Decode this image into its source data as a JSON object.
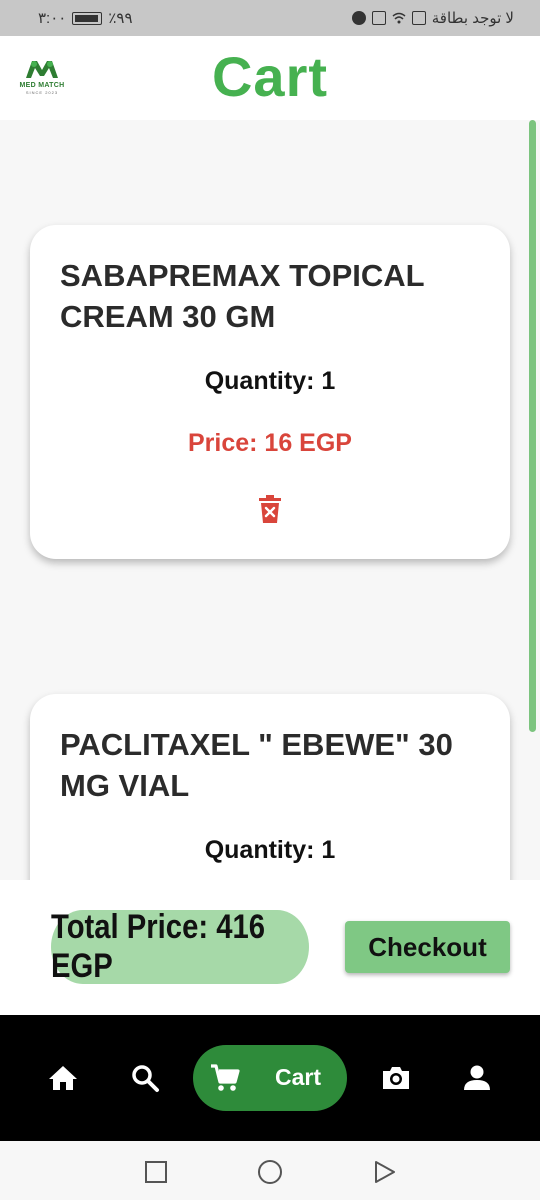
{
  "status_bar": {
    "time": "٣:٠٠",
    "battery": "٪٩٩",
    "carrier": "لا توجد بطاقة"
  },
  "header": {
    "logo_text": "MED MATCH",
    "logo_subtext": "SINCE 2023",
    "title": "Cart"
  },
  "cart_items": [
    {
      "name": "SABAPREMAX TOPICAL CREAM 30 GM",
      "quantity": "Quantity: 1",
      "price": "Price: 16 EGP"
    },
    {
      "name": "PACLITAXEL \" EBEWE\" 30 MG VIAL",
      "quantity": "Quantity: 1"
    }
  ],
  "summary": {
    "total": "Total Price: 416 EGP",
    "checkout_label": "Checkout"
  },
  "bottom_nav": {
    "items": [
      "home-icon",
      "search-icon",
      "cart-icon",
      "camera-icon",
      "person-icon"
    ],
    "active_label": "Cart"
  },
  "colors": {
    "accent": "#46b150",
    "nav_active": "#2e8b3a",
    "price": "#d9453b",
    "total_pill": "#a6d9a8",
    "checkout": "#7fc884"
  }
}
